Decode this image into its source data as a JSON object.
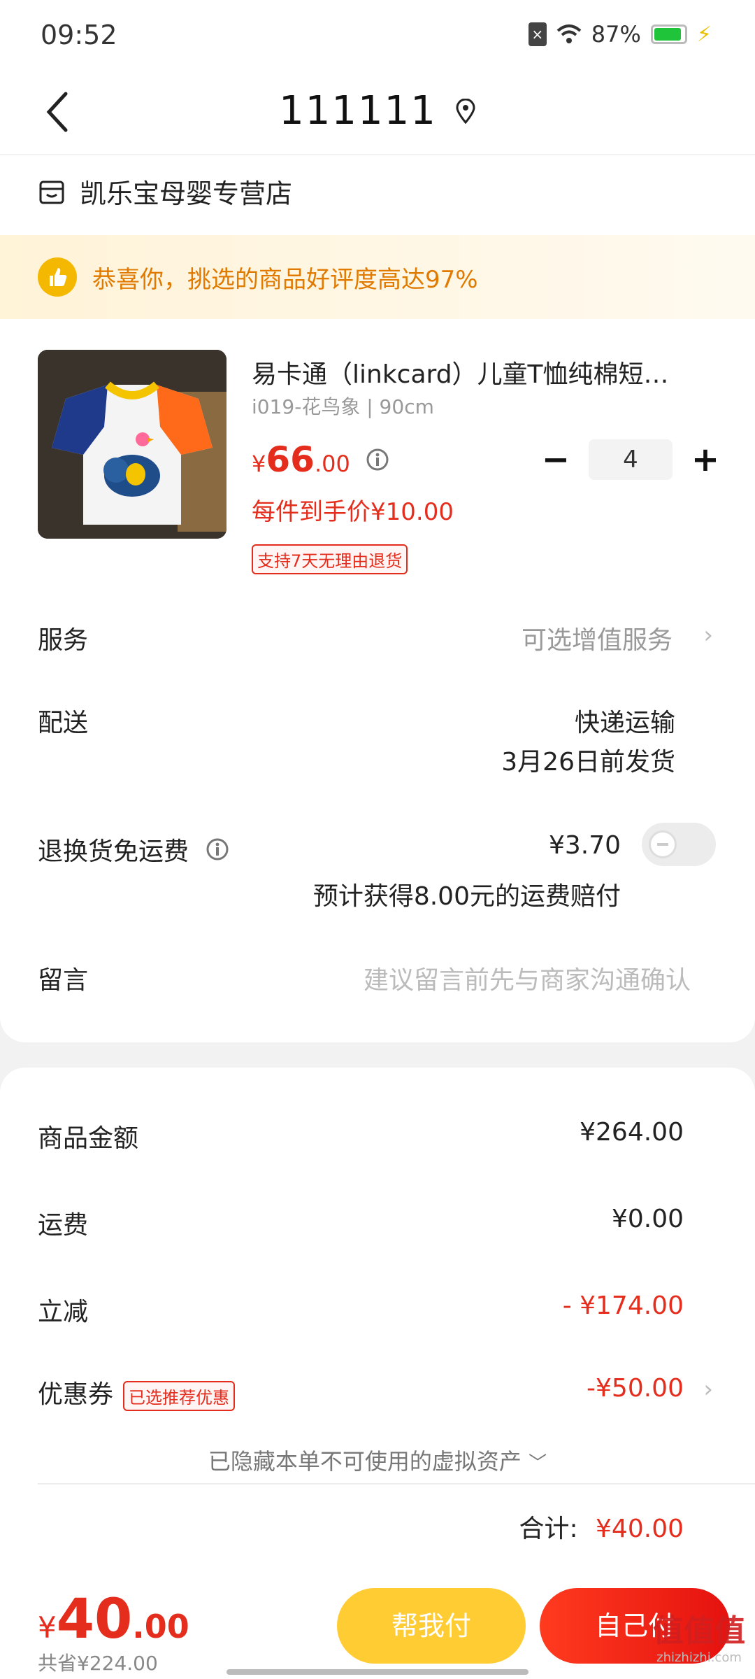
{
  "status_bar": {
    "time": "09:52",
    "battery": "87%"
  },
  "nav": {
    "title": "111111"
  },
  "store": {
    "name": "凯乐宝母婴专营店"
  },
  "promo": {
    "text": "恭喜你，挑选的商品好评度高达97%"
  },
  "product": {
    "title": "易卡通（linkcard）儿童T恤纯棉短…",
    "spec": "i019-花鸟象 | 90cm",
    "price_symbol": "¥",
    "price_int": "66",
    "price_dec": ".00",
    "unit_price": "每件到手价¥10.00",
    "return_badge": "支持7天无理由退货",
    "quantity": "4",
    "minus": "−",
    "plus": "+"
  },
  "rows": {
    "service_label": "服务",
    "service_value": "可选增值服务",
    "delivery_label": "配送",
    "delivery_method": "快递运输",
    "delivery_date": "3月26日前发货",
    "return_label": "退换货免运费",
    "return_price": "¥3.70",
    "return_note": "预计获得8.00元的运费赔付",
    "message_label": "留言",
    "message_placeholder": "建议留言前先与商家沟通确认"
  },
  "summary": {
    "goods_label": "商品金额",
    "goods_value": "¥264.00",
    "shipping_label": "运费",
    "shipping_value": "¥0.00",
    "discount_label": "立减",
    "discount_value": "- ¥174.00",
    "coupon_label": "优惠券",
    "coupon_badge": "已选推荐优惠",
    "coupon_value": "-¥50.00",
    "hidden_assets": "已隐藏本单不可使用的虚拟资产",
    "total_label": "合计:",
    "total_value": "¥40.00"
  },
  "bottom": {
    "price_symbol": "¥",
    "price_int": "40",
    "price_dec": ".00",
    "saved": "共省¥224.00",
    "help_pay": "帮我付",
    "self_pay": "自己付"
  },
  "watermark": {
    "main": "值值值",
    "sub": "zhizhizhi.com"
  },
  "colors": {
    "accent_red": "#e52d1d",
    "help_yellow": "#ffcc33",
    "promo_orange": "#e07a00"
  },
  "icons": [
    "back-icon",
    "location-pin-icon",
    "store-icon",
    "thumbs-up-icon",
    "info-icon",
    "chevron-right-icon",
    "chevron-down-icon",
    "wifi-icon",
    "battery-icon",
    "sim-icon",
    "charging-icon"
  ]
}
